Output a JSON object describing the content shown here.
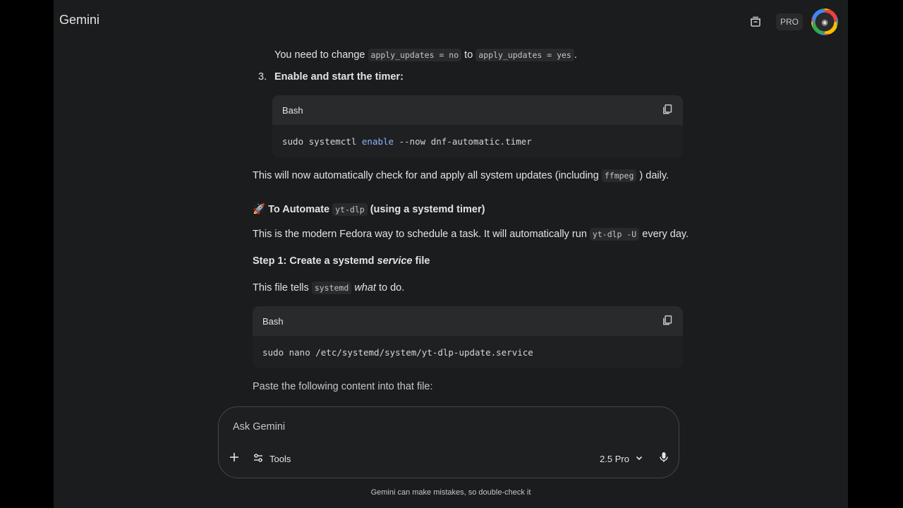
{
  "header": {
    "brand": "Gemini",
    "pro_badge": "PRO"
  },
  "step3": {
    "intro_before": "You need to change",
    "code_from": "apply_updates = no",
    "intro_mid": "to",
    "code_to": "apply_updates = yes",
    "intro_after": ".",
    "number": "3.",
    "title": "Enable and start the timer:"
  },
  "codeblock1": {
    "lang": "Bash",
    "cmd_a": "sudo systemctl ",
    "cmd_kw": "enable",
    "cmd_b": " --now dnf-automatic.timer"
  },
  "para1": {
    "text_before": "This will now automatically check for and apply all system updates (including",
    "code": "ffmpeg",
    "text_after": ") daily."
  },
  "section": {
    "emoji": "🚀",
    "title_before": "To Automate",
    "code": "yt-dlp",
    "title_after": "(using a systemd timer)"
  },
  "para2": {
    "text_before": "This is the modern Fedora way to schedule a task. It will automatically run",
    "code": "yt-dlp -U",
    "text_after": "every day."
  },
  "step1": {
    "title_before": "Step 1: Create a systemd",
    "title_em": "service",
    "title_after": "file"
  },
  "para3": {
    "text_before": "This file tells",
    "code": "systemd",
    "text_em": "what",
    "text_after": "to do."
  },
  "codeblock2": {
    "lang": "Bash",
    "cmd": "sudo nano /etc/systemd/system/yt-dlp-update.service"
  },
  "para4": "Paste the following content into that file:",
  "composer": {
    "placeholder": "Ask Gemini",
    "tools_label": "Tools",
    "model_label": "2.5 Pro"
  },
  "footer": {
    "disclaimer": "Gemini can make mistakes, so double-check it"
  },
  "icons": {
    "history": "history-icon",
    "copy": "copy-icon",
    "plus": "plus-icon",
    "tools": "tools-icon",
    "chevron": "chevron-down-icon",
    "mic": "mic-icon"
  }
}
